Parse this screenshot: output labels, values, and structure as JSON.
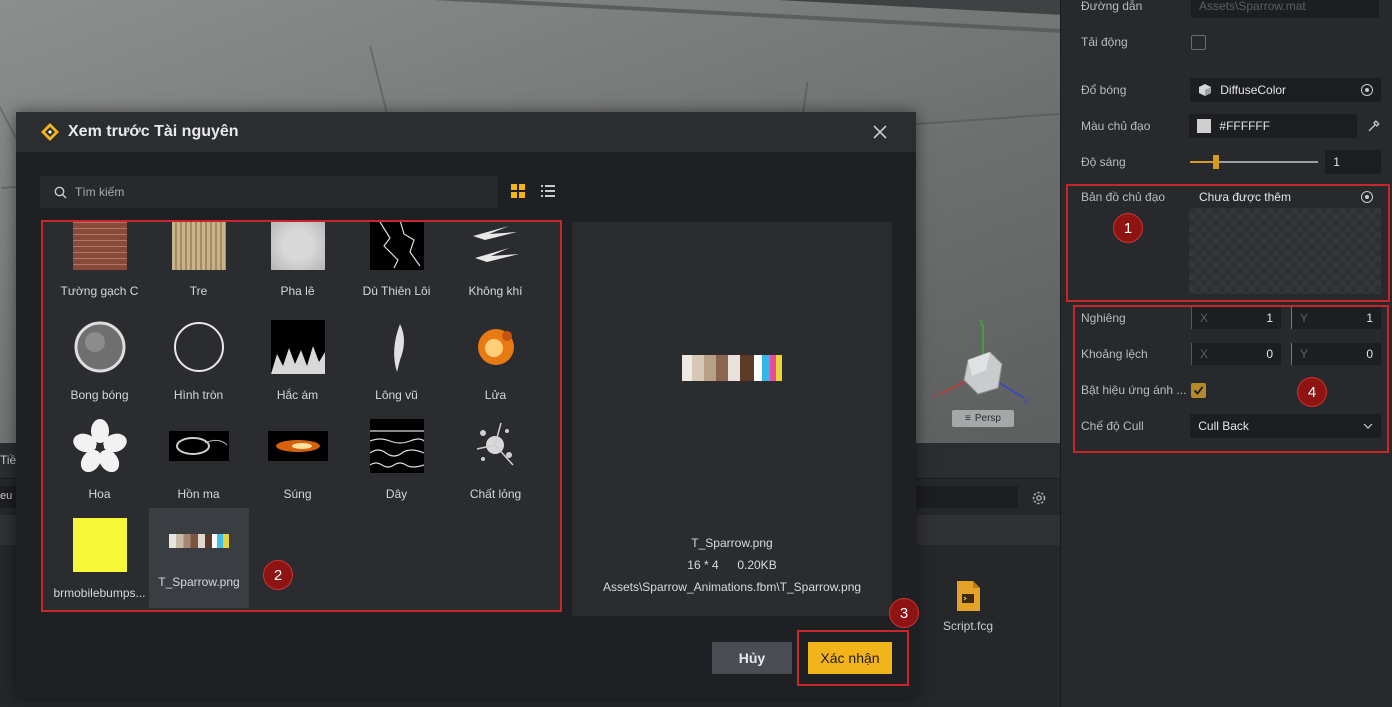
{
  "viewport": {
    "persp_label": "Persp",
    "gizmo_axes": {
      "y": "y",
      "x": "x",
      "z": "z"
    }
  },
  "bottom_panel": {
    "tab_label": "Tiề",
    "search_text": "eu",
    "script_file": "Script.fcg"
  },
  "inspector": {
    "path": {
      "label": "Đường dẫn",
      "value": "Assets\\Sparrow.mat"
    },
    "dynamic_load": {
      "label": "Tải động",
      "checked": false
    },
    "shading": {
      "label": "Đổ bóng",
      "value": "DiffuseColor"
    },
    "main_color": {
      "label": "Màu chủ đạo",
      "value": "#FFFFFF"
    },
    "brightness": {
      "label": "Độ sáng",
      "value": "1",
      "level": 0.2
    },
    "main_map": {
      "label": "Bản đồ chủ đạo",
      "value": "Chưa được thêm"
    },
    "tiling": {
      "label": "Nghiêng",
      "x_axis": "X",
      "x": "1",
      "y_axis": "Y",
      "y": "1"
    },
    "offset": {
      "label": "Khoảng lệch",
      "x_axis": "X",
      "x": "0",
      "y_axis": "Y",
      "y": "0"
    },
    "shadow_effect": {
      "label": "Bật hiệu ứng ánh ...",
      "checked": true
    },
    "cull_mode": {
      "label": "Chế độ Cull",
      "value": "Cull Back"
    }
  },
  "dialog": {
    "title": "Xem trước Tài nguyên",
    "search_placeholder": "Tìm kiếm",
    "assets": [
      {
        "name": "Tường gạch C"
      },
      {
        "name": "Tre"
      },
      {
        "name": "Pha lê"
      },
      {
        "name": "Dù Thiên Lôi"
      },
      {
        "name": "Không khí"
      },
      {
        "name": "Bong bóng"
      },
      {
        "name": "Hình tròn"
      },
      {
        "name": "Hắc ám"
      },
      {
        "name": "Lông vũ"
      },
      {
        "name": "Lửa"
      },
      {
        "name": "Hoa"
      },
      {
        "name": "Hồn ma"
      },
      {
        "name": "Súng"
      },
      {
        "name": "Dây"
      },
      {
        "name": "Chất lỏng"
      },
      {
        "name": "brmobilebumps..."
      },
      {
        "name": "T_Sparrow.png"
      }
    ],
    "selected_asset": "T_Sparrow.png",
    "preview": {
      "file_name": "T_Sparrow.png",
      "dimensions": "16 * 4",
      "size": "0.20KB",
      "path": "Assets\\Sparrow_Animations.fbm\\T_Sparrow.png"
    },
    "cancel_label": "Hủy",
    "confirm_label": "Xác nhận"
  },
  "annotations": {
    "b1": "1",
    "b2": "2",
    "b3": "3",
    "b4": "4"
  },
  "colors": {
    "accent": "#F2B31B",
    "annotation_red": "#C8262A"
  }
}
